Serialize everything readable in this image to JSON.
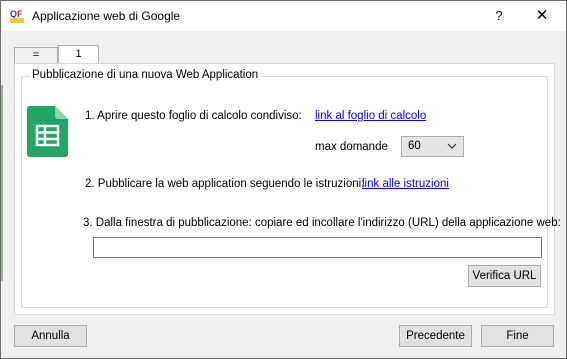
{
  "window": {
    "title": "Applicazione web di Google",
    "app_icon": "qf-app-icon",
    "help_label": "?",
    "close_label": "✕"
  },
  "tabs": [
    {
      "label": "=",
      "active": false
    },
    {
      "label": "1",
      "active": true
    }
  ],
  "group": {
    "title": "Pubblicazione di una nuova Web Application"
  },
  "step1": {
    "text": "1. Aprire questo foglio di calcolo condiviso:",
    "link": "link al foglio di calcolo"
  },
  "questions": {
    "label": "max domande",
    "selected": "60"
  },
  "step2": {
    "text": "2. Pubblicare la web application seguendo le istruzioni:",
    "link": "link alle istruzioni"
  },
  "step3": {
    "text": "3. Dalla finestra di pubblicazione: copiare ed incollare l'indirizzo (URL) della applicazione web:",
    "url_value": ""
  },
  "buttons": {
    "verify": "Verifica URL",
    "cancel": "Annulla",
    "previous": "Precedente",
    "finish": "Fine"
  },
  "colors": {
    "sheets_green": "#23a566",
    "link_blue": "#0000ee"
  }
}
